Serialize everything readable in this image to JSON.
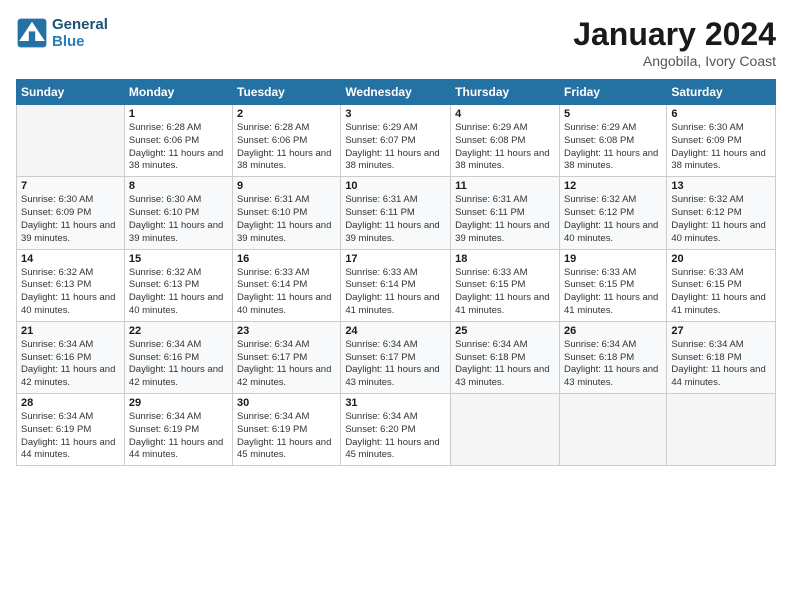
{
  "logo": {
    "line1": "General",
    "line2": "Blue"
  },
  "title": "January 2024",
  "subtitle": "Angobila, Ivory Coast",
  "days_header": [
    "Sunday",
    "Monday",
    "Tuesday",
    "Wednesday",
    "Thursday",
    "Friday",
    "Saturday"
  ],
  "weeks": [
    [
      {
        "day": "",
        "info": ""
      },
      {
        "day": "1",
        "info": "Sunrise: 6:28 AM\nSunset: 6:06 PM\nDaylight: 11 hours and 38 minutes."
      },
      {
        "day": "2",
        "info": "Sunrise: 6:28 AM\nSunset: 6:06 PM\nDaylight: 11 hours and 38 minutes."
      },
      {
        "day": "3",
        "info": "Sunrise: 6:29 AM\nSunset: 6:07 PM\nDaylight: 11 hours and 38 minutes."
      },
      {
        "day": "4",
        "info": "Sunrise: 6:29 AM\nSunset: 6:08 PM\nDaylight: 11 hours and 38 minutes."
      },
      {
        "day": "5",
        "info": "Sunrise: 6:29 AM\nSunset: 6:08 PM\nDaylight: 11 hours and 38 minutes."
      },
      {
        "day": "6",
        "info": "Sunrise: 6:30 AM\nSunset: 6:09 PM\nDaylight: 11 hours and 38 minutes."
      }
    ],
    [
      {
        "day": "7",
        "info": "Sunrise: 6:30 AM\nSunset: 6:09 PM\nDaylight: 11 hours and 39 minutes."
      },
      {
        "day": "8",
        "info": "Sunrise: 6:30 AM\nSunset: 6:10 PM\nDaylight: 11 hours and 39 minutes."
      },
      {
        "day": "9",
        "info": "Sunrise: 6:31 AM\nSunset: 6:10 PM\nDaylight: 11 hours and 39 minutes."
      },
      {
        "day": "10",
        "info": "Sunrise: 6:31 AM\nSunset: 6:11 PM\nDaylight: 11 hours and 39 minutes."
      },
      {
        "day": "11",
        "info": "Sunrise: 6:31 AM\nSunset: 6:11 PM\nDaylight: 11 hours and 39 minutes."
      },
      {
        "day": "12",
        "info": "Sunrise: 6:32 AM\nSunset: 6:12 PM\nDaylight: 11 hours and 40 minutes."
      },
      {
        "day": "13",
        "info": "Sunrise: 6:32 AM\nSunset: 6:12 PM\nDaylight: 11 hours and 40 minutes."
      }
    ],
    [
      {
        "day": "14",
        "info": "Sunrise: 6:32 AM\nSunset: 6:13 PM\nDaylight: 11 hours and 40 minutes."
      },
      {
        "day": "15",
        "info": "Sunrise: 6:32 AM\nSunset: 6:13 PM\nDaylight: 11 hours and 40 minutes."
      },
      {
        "day": "16",
        "info": "Sunrise: 6:33 AM\nSunset: 6:14 PM\nDaylight: 11 hours and 40 minutes."
      },
      {
        "day": "17",
        "info": "Sunrise: 6:33 AM\nSunset: 6:14 PM\nDaylight: 11 hours and 41 minutes."
      },
      {
        "day": "18",
        "info": "Sunrise: 6:33 AM\nSunset: 6:15 PM\nDaylight: 11 hours and 41 minutes."
      },
      {
        "day": "19",
        "info": "Sunrise: 6:33 AM\nSunset: 6:15 PM\nDaylight: 11 hours and 41 minutes."
      },
      {
        "day": "20",
        "info": "Sunrise: 6:33 AM\nSunset: 6:15 PM\nDaylight: 11 hours and 41 minutes."
      }
    ],
    [
      {
        "day": "21",
        "info": "Sunrise: 6:34 AM\nSunset: 6:16 PM\nDaylight: 11 hours and 42 minutes."
      },
      {
        "day": "22",
        "info": "Sunrise: 6:34 AM\nSunset: 6:16 PM\nDaylight: 11 hours and 42 minutes."
      },
      {
        "day": "23",
        "info": "Sunrise: 6:34 AM\nSunset: 6:17 PM\nDaylight: 11 hours and 42 minutes."
      },
      {
        "day": "24",
        "info": "Sunrise: 6:34 AM\nSunset: 6:17 PM\nDaylight: 11 hours and 43 minutes."
      },
      {
        "day": "25",
        "info": "Sunrise: 6:34 AM\nSunset: 6:18 PM\nDaylight: 11 hours and 43 minutes."
      },
      {
        "day": "26",
        "info": "Sunrise: 6:34 AM\nSunset: 6:18 PM\nDaylight: 11 hours and 43 minutes."
      },
      {
        "day": "27",
        "info": "Sunrise: 6:34 AM\nSunset: 6:18 PM\nDaylight: 11 hours and 44 minutes."
      }
    ],
    [
      {
        "day": "28",
        "info": "Sunrise: 6:34 AM\nSunset: 6:19 PM\nDaylight: 11 hours and 44 minutes."
      },
      {
        "day": "29",
        "info": "Sunrise: 6:34 AM\nSunset: 6:19 PM\nDaylight: 11 hours and 44 minutes."
      },
      {
        "day": "30",
        "info": "Sunrise: 6:34 AM\nSunset: 6:19 PM\nDaylight: 11 hours and 45 minutes."
      },
      {
        "day": "31",
        "info": "Sunrise: 6:34 AM\nSunset: 6:20 PM\nDaylight: 11 hours and 45 minutes."
      },
      {
        "day": "",
        "info": ""
      },
      {
        "day": "",
        "info": ""
      },
      {
        "day": "",
        "info": ""
      }
    ]
  ]
}
